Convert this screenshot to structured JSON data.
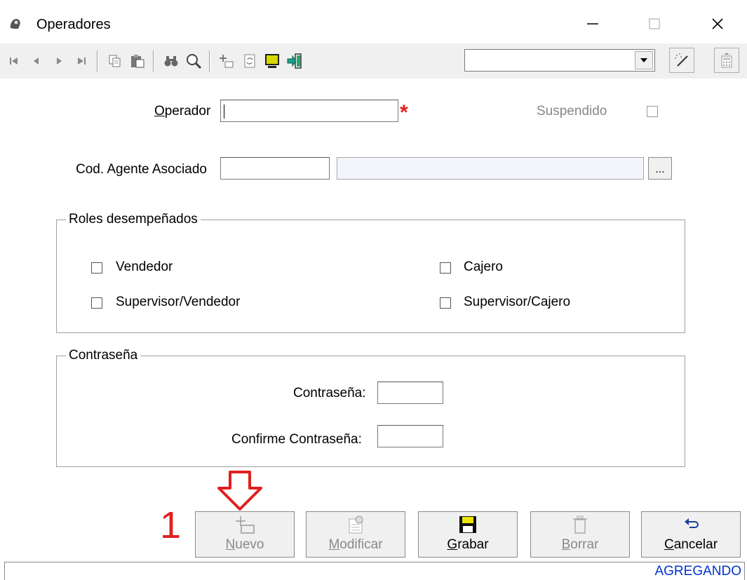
{
  "window": {
    "title": "Operadores"
  },
  "form": {
    "operador_label_first": "O",
    "operador_label_rest": "perador",
    "operador_value": "",
    "required_mark": "*",
    "suspendido_label": "Suspendido",
    "agente_label": "Cod. Agente Asociado",
    "agente_code": "",
    "agente_name": "",
    "browse_label": "..."
  },
  "roles": {
    "title": "Roles desempeñados",
    "vendedor": "Vendedor",
    "supervisor_vendedor": "Supervisor/Vendedor",
    "cajero": "Cajero",
    "supervisor_cajero": "Supervisor/Cajero"
  },
  "password": {
    "title": "Contraseña",
    "pass_label": "Contraseña:",
    "confirm_label": "Confirme Contraseña:"
  },
  "annotation": {
    "step_number": "1",
    "arrow_color": "#e02020"
  },
  "buttons": {
    "nuevo_first": "N",
    "nuevo_rest": "uevo",
    "modificar_first": "M",
    "modificar_rest": "odificar",
    "grabar_first": "G",
    "grabar_rest": "rabar",
    "borrar_first": "B",
    "borrar_rest": "orrar",
    "cancelar_first": "C",
    "cancelar_rest": "ancelar"
  },
  "status": {
    "text": "AGREGANDO",
    "color": "#0033cc"
  }
}
